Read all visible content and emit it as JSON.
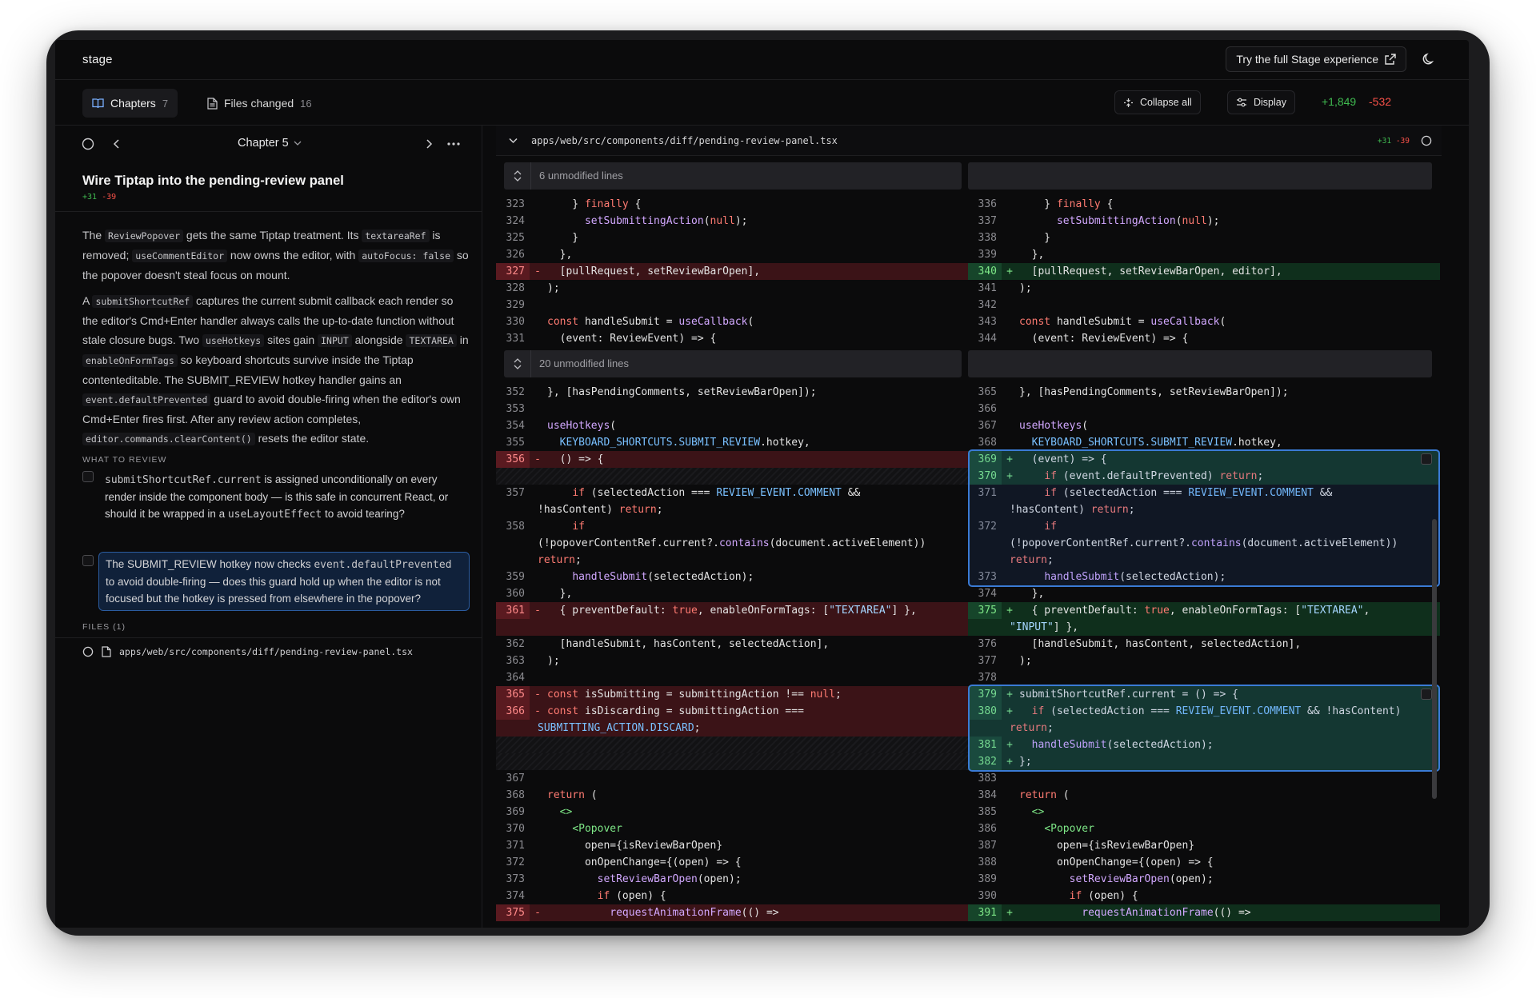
{
  "app": {
    "name": "stage",
    "cta_label": "Try the full Stage experience"
  },
  "tabs": {
    "chapters": {
      "label": "Chapters",
      "count": "7"
    },
    "files": {
      "label": "Files changed",
      "count": "16"
    }
  },
  "toolbar": {
    "collapse_label": "Collapse all",
    "display_label": "Display",
    "additions": "+1,849",
    "deletions": "-532"
  },
  "chapter": {
    "nav_label": "Chapter 5",
    "title": "Wire Tiptap into the pending-review panel",
    "additions": "+31",
    "deletions": "-39"
  },
  "description": {
    "p1": [
      "The ",
      "ReviewPopover",
      " gets the same Tiptap treatment. Its ",
      "textareaRef",
      " is removed; ",
      "useCommentEditor",
      " now owns the editor, with ",
      "autoFocus: false",
      " so the popover doesn't steal focus on mount."
    ],
    "p2": [
      "A ",
      "submitShortcutRef",
      " captures the current submit callback each render so the editor's Cmd+Enter handler always calls the up-to-date function without stale closure bugs. Two ",
      "useHotkeys",
      " sites gain ",
      "INPUT",
      " alongside ",
      "TEXTAREA",
      " in ",
      "enableOnFormTags",
      " so keyboard shortcuts survive inside the Tiptap contenteditable. The SUBMIT_REVIEW hotkey handler gains an ",
      "event.defaultPrevented",
      " guard to avoid double-firing when the editor's own Cmd+Enter fires first. After any review action completes, ",
      "editor.commands.clearContent()",
      " resets the editor state."
    ]
  },
  "review": {
    "label": "WHAT TO REVIEW",
    "items": [
      [
        "submitShortcutRef.current",
        " is assigned unconditionally on every render inside the component body — is this safe in concurrent React, or should it be wrapped in a ",
        "useLayoutEffect",
        " to avoid tearing?"
      ],
      [
        "The SUBMIT_REVIEW hotkey now checks ",
        "event.defaultPrevented",
        " to avoid double-firing — does this guard hold up when the editor is not focused but the hotkey is pressed from elsewhere in the popover?"
      ]
    ]
  },
  "files_section": {
    "label": "FILES",
    "count": "(1)",
    "items": [
      "apps/web/src/components/diff/pending-review-panel.tsx"
    ]
  },
  "diff": {
    "file_path": "apps/web/src/components/diff/pending-review-panel.tsx",
    "additions": "+31",
    "deletions": "-39",
    "hunk1": "6 unmodified lines",
    "hunk2": "20 unmodified lines",
    "left": [
      {
        "n": "323",
        "t": "ctx",
        "c": "    } finally {"
      },
      {
        "n": "324",
        "t": "ctx",
        "c": "      setSubmittingAction(null);"
      },
      {
        "n": "325",
        "t": "ctx",
        "c": "    }"
      },
      {
        "n": "326",
        "t": "ctx",
        "c": "  },"
      },
      {
        "n": "327",
        "t": "del",
        "c": "  [pullRequest, setReviewBarOpen],"
      },
      {
        "n": "328",
        "t": "ctx",
        "c": ");"
      },
      {
        "n": "329",
        "t": "ctx",
        "c": ""
      },
      {
        "n": "330",
        "t": "ctx",
        "c": "const handleSubmit = useCallback("
      },
      {
        "n": "331",
        "t": "ctx",
        "c": "  (event: ReviewEvent) => {"
      },
      {
        "n": "352",
        "t": "ctx",
        "c": "}, [hasPendingComments, setReviewBarOpen]);"
      },
      {
        "n": "353",
        "t": "ctx",
        "c": ""
      },
      {
        "n": "354",
        "t": "ctx",
        "c": "useHotkeys("
      },
      {
        "n": "355",
        "t": "ctx",
        "c": "  KEYBOARD_SHORTCUTS.SUBMIT_REVIEW.hotkey,"
      },
      {
        "n": "356",
        "t": "del",
        "c": "  () => {"
      },
      {
        "n": "",
        "t": "hatch",
        "c": ""
      },
      {
        "n": "357",
        "t": "ctx",
        "c": "    if (selectedAction === REVIEW_EVENT.COMMENT &&"
      },
      {
        "n": "",
        "t": "cont",
        "c": "!hasContent) return;"
      },
      {
        "n": "358",
        "t": "ctx",
        "c": "    if"
      },
      {
        "n": "",
        "t": "cont",
        "c": "(!popoverContentRef.current?.contains(document.activeElement))"
      },
      {
        "n": "",
        "t": "cont",
        "c": "return;"
      },
      {
        "n": "359",
        "t": "ctx",
        "c": "    handleSubmit(selectedAction);"
      },
      {
        "n": "360",
        "t": "ctx",
        "c": "  },"
      },
      {
        "n": "361",
        "t": "del",
        "c": "  { preventDefault: true, enableOnFormTags: [\"TEXTAREA\"] },"
      },
      {
        "n": "",
        "t": "delc",
        "c": ""
      },
      {
        "n": "362",
        "t": "ctx",
        "c": "  [handleSubmit, hasContent, selectedAction],"
      },
      {
        "n": "363",
        "t": "ctx",
        "c": ");"
      },
      {
        "n": "364",
        "t": "ctx",
        "c": ""
      },
      {
        "n": "365",
        "t": "del",
        "c": "const isSubmitting = submittingAction !== null;"
      },
      {
        "n": "366",
        "t": "del",
        "c": "const isDiscarding = submittingAction ==="
      },
      {
        "n": "",
        "t": "delc",
        "c": "SUBMITTING_ACTION.DISCARD;"
      },
      {
        "n": "",
        "t": "hatch",
        "c": ""
      },
      {
        "n": "",
        "t": "hatch",
        "c": ""
      },
      {
        "n": "367",
        "t": "ctx",
        "c": ""
      },
      {
        "n": "368",
        "t": "ctx",
        "c": "return ("
      },
      {
        "n": "369",
        "t": "ctx",
        "c": "  <>"
      },
      {
        "n": "370",
        "t": "ctx",
        "c": "    <Popover"
      },
      {
        "n": "371",
        "t": "ctx",
        "c": "      open={isReviewBarOpen}"
      },
      {
        "n": "372",
        "t": "ctx",
        "c": "      onOpenChange={(open) => {"
      },
      {
        "n": "373",
        "t": "ctx",
        "c": "        setReviewBarOpen(open);"
      },
      {
        "n": "374",
        "t": "ctx",
        "c": "        if (open) {"
      },
      {
        "n": "375",
        "t": "del",
        "c": "          requestAnimationFrame(() =>"
      }
    ],
    "right": [
      {
        "n": "336",
        "t": "ctx",
        "c": "    } finally {"
      },
      {
        "n": "337",
        "t": "ctx",
        "c": "      setSubmittingAction(null);"
      },
      {
        "n": "338",
        "t": "ctx",
        "c": "    }"
      },
      {
        "n": "339",
        "t": "ctx",
        "c": "  },"
      },
      {
        "n": "340",
        "t": "add",
        "c": "  [pullRequest, setReviewBarOpen, editor],"
      },
      {
        "n": "341",
        "t": "ctx",
        "c": ");"
      },
      {
        "n": "342",
        "t": "ctx",
        "c": ""
      },
      {
        "n": "343",
        "t": "ctx",
        "c": "const handleSubmit = useCallback("
      },
      {
        "n": "344",
        "t": "ctx",
        "c": "  (event: ReviewEvent) => {"
      },
      {
        "n": "365",
        "t": "ctx",
        "c": "}, [hasPendingComments, setReviewBarOpen]);"
      },
      {
        "n": "366",
        "t": "ctx",
        "c": ""
      },
      {
        "n": "367",
        "t": "ctx",
        "c": "useHotkeys("
      },
      {
        "n": "368",
        "t": "ctx",
        "c": "  KEYBOARD_SHORTCUTS.SUBMIT_REVIEW.hotkey,"
      },
      {
        "n": "369",
        "t": "add",
        "c": "  (event) => {"
      },
      {
        "n": "370",
        "t": "add",
        "c": "    if (event.defaultPrevented) return;"
      },
      {
        "n": "371",
        "t": "ctx",
        "c": "    if (selectedAction === REVIEW_EVENT.COMMENT &&"
      },
      {
        "n": "",
        "t": "cont",
        "c": "!hasContent) return;"
      },
      {
        "n": "372",
        "t": "ctx",
        "c": "    if"
      },
      {
        "n": "",
        "t": "cont",
        "c": "(!popoverContentRef.current?.contains(document.activeElement))"
      },
      {
        "n": "",
        "t": "cont",
        "c": "return;"
      },
      {
        "n": "373",
        "t": "ctx",
        "c": "    handleSubmit(selectedAction);"
      },
      {
        "n": "374",
        "t": "ctx",
        "c": "  },"
      },
      {
        "n": "375",
        "t": "add",
        "c": "  { preventDefault: true, enableOnFormTags: [\"TEXTAREA\","
      },
      {
        "n": "",
        "t": "addc",
        "c": "\"INPUT\"] },"
      },
      {
        "n": "376",
        "t": "ctx",
        "c": "  [handleSubmit, hasContent, selectedAction],"
      },
      {
        "n": "377",
        "t": "ctx",
        "c": ");"
      },
      {
        "n": "378",
        "t": "ctx",
        "c": ""
      },
      {
        "n": "379",
        "t": "add",
        "c": "submitShortcutRef.current = () => {"
      },
      {
        "n": "380",
        "t": "add",
        "c": "  if (selectedAction === REVIEW_EVENT.COMMENT && !hasContent)"
      },
      {
        "n": "",
        "t": "addc",
        "c": "return;"
      },
      {
        "n": "381",
        "t": "add",
        "c": "  handleSubmit(selectedAction);"
      },
      {
        "n": "382",
        "t": "add",
        "c": "};"
      },
      {
        "n": "383",
        "t": "ctx",
        "c": ""
      },
      {
        "n": "384",
        "t": "ctx",
        "c": "return ("
      },
      {
        "n": "385",
        "t": "ctx",
        "c": "  <>"
      },
      {
        "n": "386",
        "t": "ctx",
        "c": "    <Popover"
      },
      {
        "n": "387",
        "t": "ctx",
        "c": "      open={isReviewBarOpen}"
      },
      {
        "n": "388",
        "t": "ctx",
        "c": "      onOpenChange={(open) => {"
      },
      {
        "n": "389",
        "t": "ctx",
        "c": "        setReviewBarOpen(open);"
      },
      {
        "n": "390",
        "t": "ctx",
        "c": "        if (open) {"
      },
      {
        "n": "391",
        "t": "add",
        "c": "          requestAnimationFrame(() =>"
      }
    ]
  }
}
